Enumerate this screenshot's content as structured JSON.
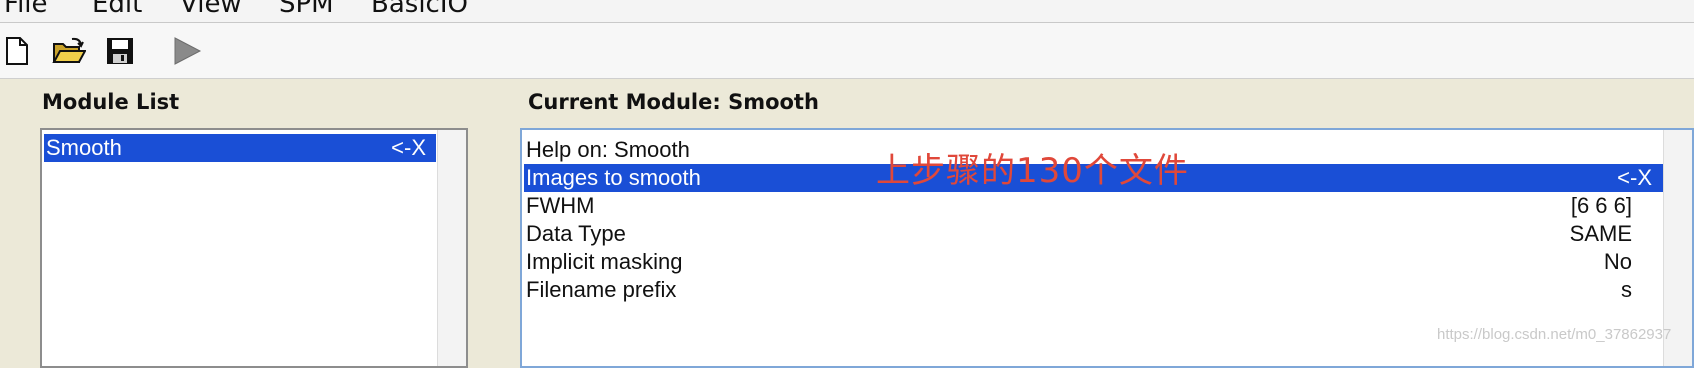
{
  "menu": {
    "items": [
      "File",
      "Edit",
      "View",
      "SPM",
      "BasicIO"
    ]
  },
  "toolbar": {
    "buttons": [
      "new-file-icon",
      "open-folder-icon",
      "save-icon",
      "run-icon"
    ]
  },
  "module_list": {
    "title": "Module List",
    "items": [
      {
        "label": "Smooth",
        "value": "<-X",
        "selected": true
      }
    ]
  },
  "current_module": {
    "title": "Current Module: Smooth",
    "items": [
      {
        "label": "Help on: Smooth",
        "value": ""
      },
      {
        "label": "Images to smooth",
        "value": "<-X",
        "selected": true
      },
      {
        "label": "FWHM",
        "value": "[6 6 6]"
      },
      {
        "label": "Data Type",
        "value": "SAME"
      },
      {
        "label": "Implicit masking",
        "value": "No"
      },
      {
        "label": "Filename prefix",
        "value": "s"
      }
    ]
  },
  "annotation": "上步骤的130个文件",
  "watermark": "https://blog.csdn.net/m0_37862937",
  "colors": {
    "selection": "#1a4fd6",
    "annotation": "#e0483a",
    "background": "#ece9d8"
  }
}
